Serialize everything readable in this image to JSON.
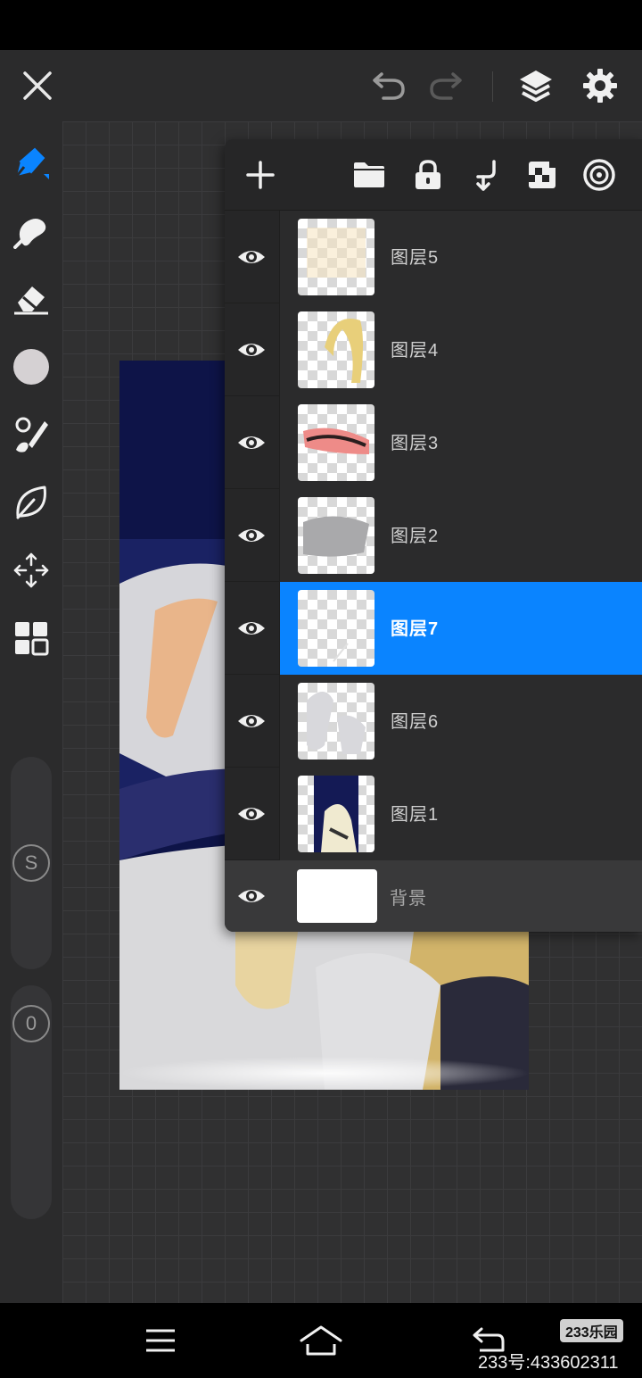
{
  "toolbar": {
    "close": "close-icon",
    "undo": "undo-icon",
    "redo": "redo-icon",
    "layers": "layers-icon",
    "settings": "gear-icon"
  },
  "tools": [
    {
      "name": "pen-tool",
      "icon": "pen-icon",
      "active": true
    },
    {
      "name": "smudge-tool",
      "icon": "smudge-icon"
    },
    {
      "name": "eraser-tool",
      "icon": "eraser-icon"
    },
    {
      "name": "color-swatch",
      "icon": "color-circle",
      "color": "#d5d1d3"
    },
    {
      "name": "brush-tool",
      "icon": "brush-icon"
    },
    {
      "name": "blur-tool",
      "icon": "leaf-icon"
    },
    {
      "name": "transform-tool",
      "icon": "move-icon"
    },
    {
      "name": "gallery-tool",
      "icon": "grid-icon"
    }
  ],
  "sliders": {
    "size_label": "S",
    "opacity_label": "0"
  },
  "layers_panel": {
    "actions": [
      "add-icon",
      "folder-icon",
      "lock-icon",
      "merge-down-icon",
      "transparency-icon",
      "blend-icon"
    ],
    "layers": [
      {
        "name": "图层5",
        "visible": true,
        "selected": false
      },
      {
        "name": "图层4",
        "visible": true,
        "selected": false
      },
      {
        "name": "图层3",
        "visible": true,
        "selected": false
      },
      {
        "name": "图层2",
        "visible": true,
        "selected": false
      },
      {
        "name": "图层7",
        "visible": true,
        "selected": true
      },
      {
        "name": "图层6",
        "visible": true,
        "selected": false
      },
      {
        "name": "图层1",
        "visible": true,
        "selected": false
      }
    ],
    "background": {
      "name": "背景",
      "visible": true
    }
  },
  "nav": {
    "menu": "menu-icon",
    "home": "home-icon",
    "back": "back-icon"
  },
  "watermark": {
    "logo": "233乐园",
    "id": "233号:433602311"
  },
  "colors": {
    "accent": "#0a84ff",
    "panel": "#262627",
    "toolbar": "#2b2b2c"
  }
}
